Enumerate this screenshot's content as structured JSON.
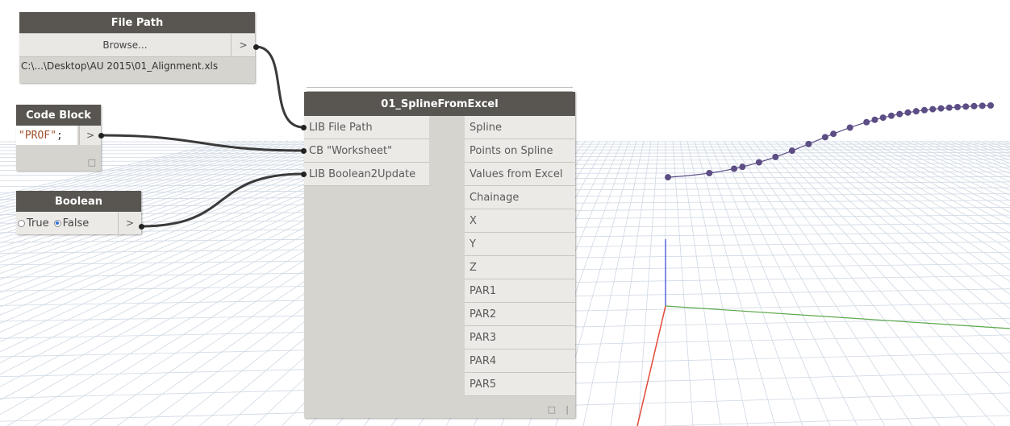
{
  "colors": {
    "node_header": "#595651",
    "node_body": "#d6d4cf",
    "wire": "#3a3a3a",
    "point": "#5c4d85",
    "axis_x": "#e24a3a",
    "axis_y": "#5aa84a",
    "axis_z": "#5566dd",
    "grid": "#cfd8e4"
  },
  "nodes": {
    "file_path": {
      "title": "File Path",
      "browse_label": "Browse...",
      "output_arrow": ">",
      "value": "C:\\...\\Desktop\\AU 2015\\01_Alignment.xls"
    },
    "code_block": {
      "title": "Code Block",
      "code_string": "\"PROF\"",
      "code_semicolon": ";",
      "output_arrow": ">",
      "footer_icon": "□"
    },
    "boolean": {
      "title": "Boolean",
      "option_true": "True",
      "option_false": "False",
      "selected": "False",
      "output_arrow": ">"
    },
    "spline_from_excel": {
      "title": "01_SplineFromExcel",
      "inputs": [
        "LIB File Path",
        "CB \"Worksheet\"",
        "LIB Boolean2Update"
      ],
      "outputs": [
        "Spline",
        "Points on Spline",
        "Values from Excel",
        "Chainage",
        "X",
        "Y",
        "Z",
        "PAR1",
        "PAR2",
        "PAR3",
        "PAR4",
        "PAR5"
      ],
      "footer_icon": "□",
      "footer_mark": "|"
    }
  },
  "viewport": {
    "spline_point_count": 40
  }
}
